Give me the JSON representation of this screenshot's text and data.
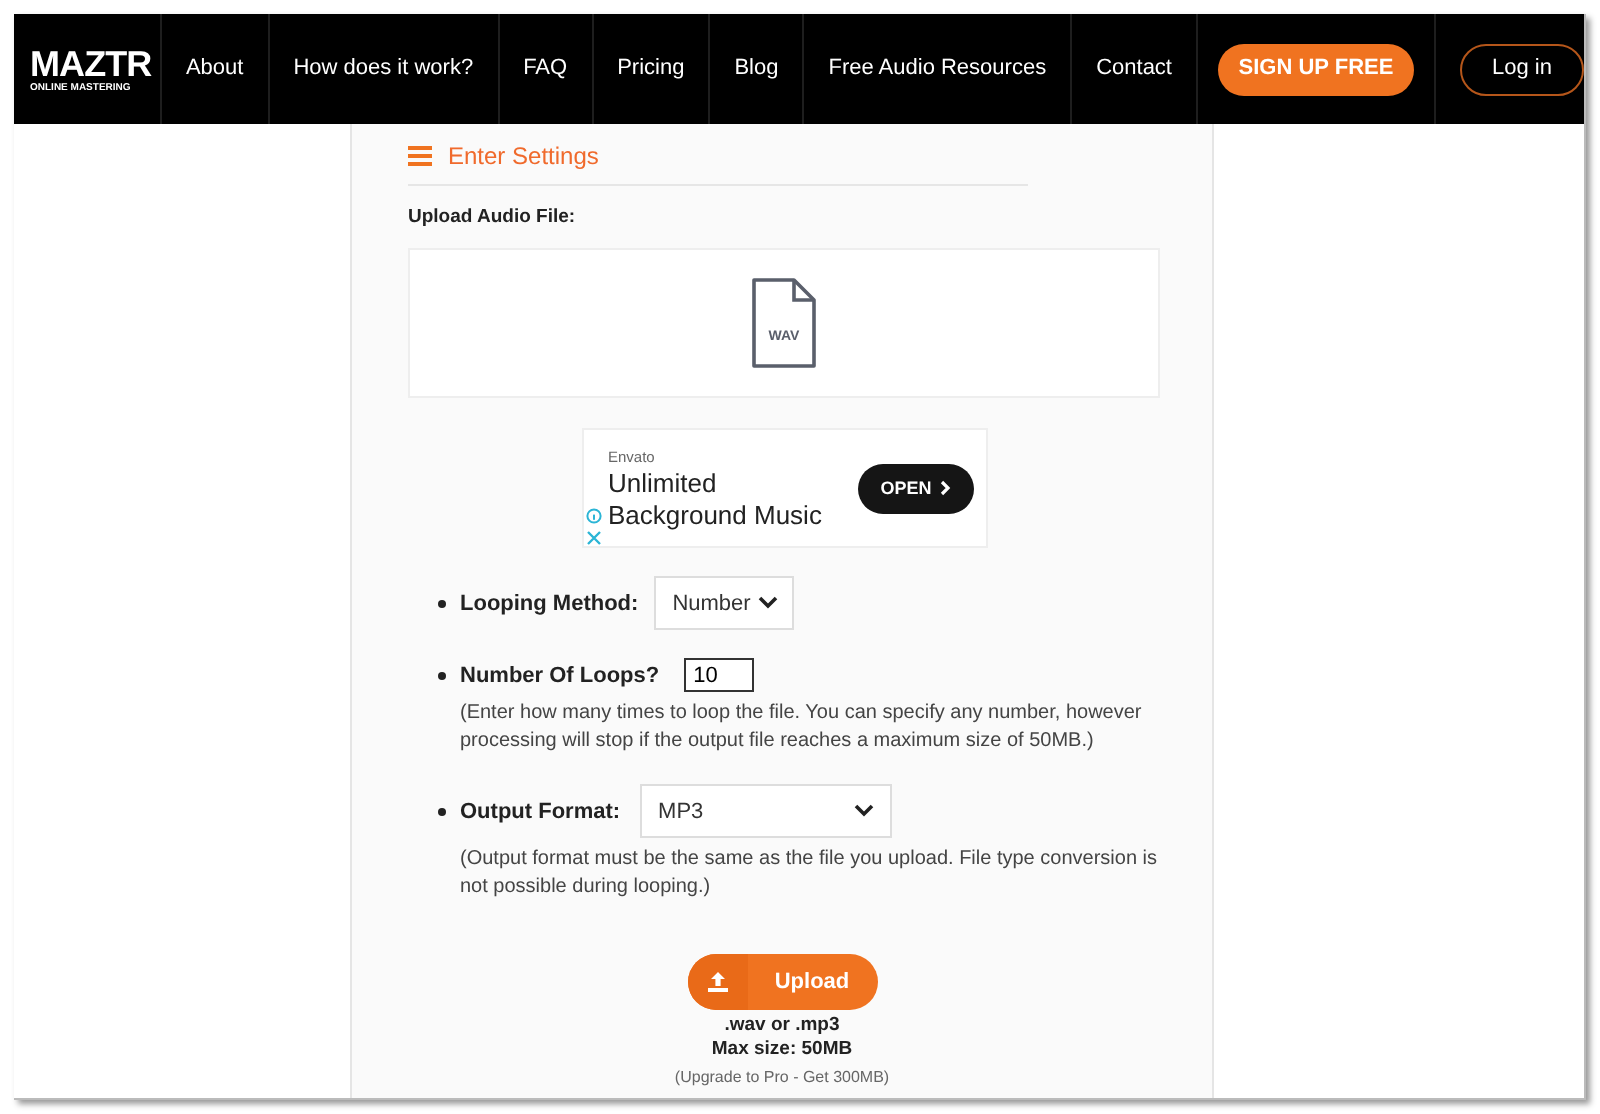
{
  "nav": {
    "logo": {
      "name": "MAZTR",
      "tagline": "ONLINE MASTERING"
    },
    "links": [
      "About",
      "How does it work?",
      "FAQ",
      "Pricing",
      "Blog",
      "Free Audio Resources",
      "Contact"
    ],
    "signup": "SIGN UP FREE",
    "login": "Log in"
  },
  "settings": {
    "title": "Enter Settings",
    "upload_label": "Upload Audio File:",
    "file_type": "WAV"
  },
  "ad": {
    "brand": "Envato",
    "headline": "Unlimited Background Music",
    "button": "OPEN"
  },
  "options": [
    {
      "kind": "select",
      "label": "Looping Method:",
      "value": "Number"
    },
    {
      "kind": "text",
      "label": "Number Of Loops?",
      "value": "10",
      "note": "(Enter how many times to loop the file. You can specify any number, however processing will stop if the output file reaches a maximum size of 50MB.)"
    },
    {
      "kind": "select-wide",
      "label": "Output Format:",
      "value": "MP3",
      "note": "(Output format must be the same as the file you upload. File type conversion is not possible during looping.)"
    }
  ],
  "upload": {
    "button": "Upload",
    "formats": ".wav or .mp3",
    "max_size": "Max size: 50MB",
    "upgrade": "(Upgrade to Pro - Get 300MB)"
  }
}
